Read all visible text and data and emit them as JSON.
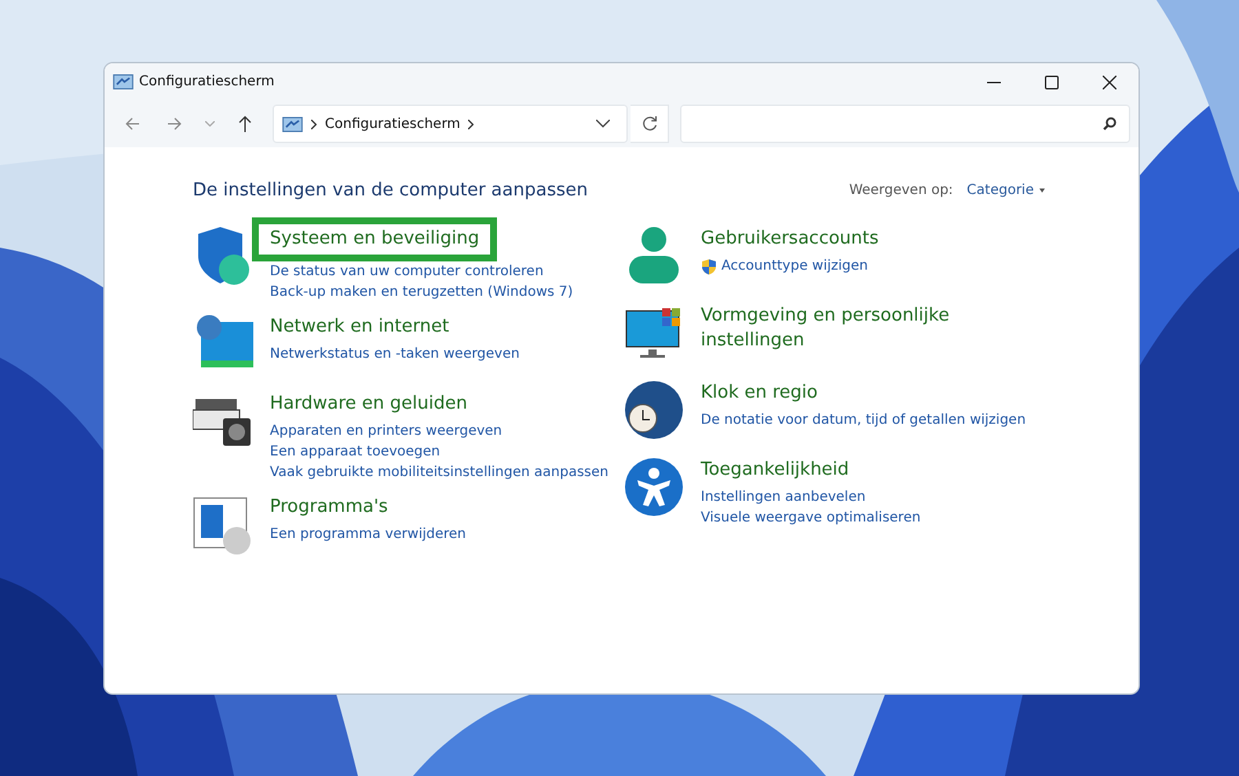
{
  "window": {
    "title": "Configuratiescherm"
  },
  "address_bar": {
    "breadcrumb": [
      "Configuratiescherm"
    ]
  },
  "heading": "De instellingen van de computer aanpassen",
  "view_by": {
    "label": "Weergeven op:",
    "value": "Categorie"
  },
  "columns": [
    [
      {
        "title": "Systeem en beveiliging",
        "highlighted": true,
        "links": [
          {
            "text": "De status van uw computer controleren",
            "admin": false
          },
          {
            "text": "Back-up maken en terugzetten (Windows 7)",
            "admin": false
          }
        ]
      },
      {
        "title": "Netwerk en internet",
        "highlighted": false,
        "links": [
          {
            "text": "Netwerkstatus en -taken weergeven",
            "admin": false
          }
        ]
      },
      {
        "title": "Hardware en geluiden",
        "highlighted": false,
        "links": [
          {
            "text": "Apparaten en printers weergeven",
            "admin": false
          },
          {
            "text": "Een apparaat toevoegen",
            "admin": false
          },
          {
            "text": "Vaak gebruikte mobiliteitsinstellingen aanpassen",
            "admin": false
          }
        ]
      },
      {
        "title": "Programma's",
        "highlighted": false,
        "links": [
          {
            "text": "Een programma verwijderen",
            "admin": false
          }
        ]
      }
    ],
    [
      {
        "title": "Gebruikersaccounts",
        "highlighted": false,
        "links": [
          {
            "text": "Accounttype wijzigen",
            "admin": true
          }
        ]
      },
      {
        "title": "Vormgeving en persoonlijke instellingen",
        "highlighted": false
      },
      {
        "title": "Klok en regio",
        "highlighted": false,
        "links": [
          {
            "text": "De notatie voor datum, tijd of getallen wijzigen",
            "admin": false
          }
        ]
      },
      {
        "title": "Toegankelijkheid",
        "highlighted": false,
        "links": [
          {
            "text": "Instellingen aanbevelen",
            "admin": false
          },
          {
            "text": "Visuele weergave optimaliseren",
            "admin": false
          }
        ]
      }
    ]
  ]
}
